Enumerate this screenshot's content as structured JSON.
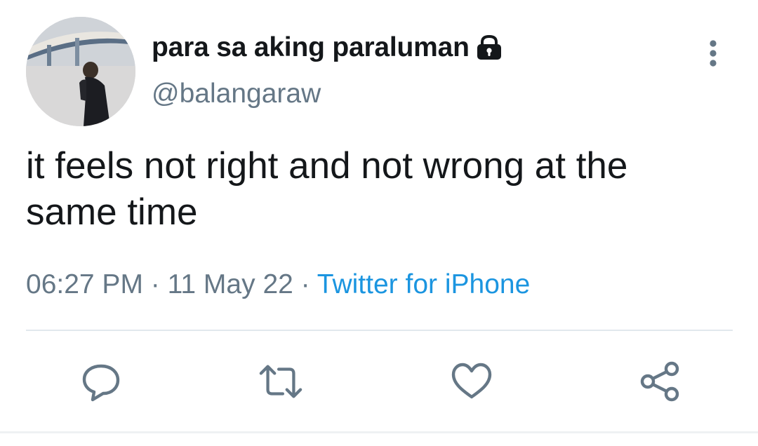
{
  "tweet": {
    "display_name": "para sa aking paraluman",
    "handle": "@balangaraw",
    "text": "it feels not right and not wrong at the same time",
    "time": "06:27 PM",
    "date": "11 May 22",
    "source": "Twitter for iPhone",
    "separator": " · "
  },
  "icons": {
    "protected": "lock-icon",
    "more": "more-vertical-icon",
    "reply": "reply-icon",
    "retweet": "retweet-icon",
    "like": "heart-icon",
    "share": "share-icon"
  },
  "colors": {
    "text": "#14171a",
    "secondary": "#657786",
    "link": "#1b95e0",
    "divider": "#e1e8ed"
  }
}
